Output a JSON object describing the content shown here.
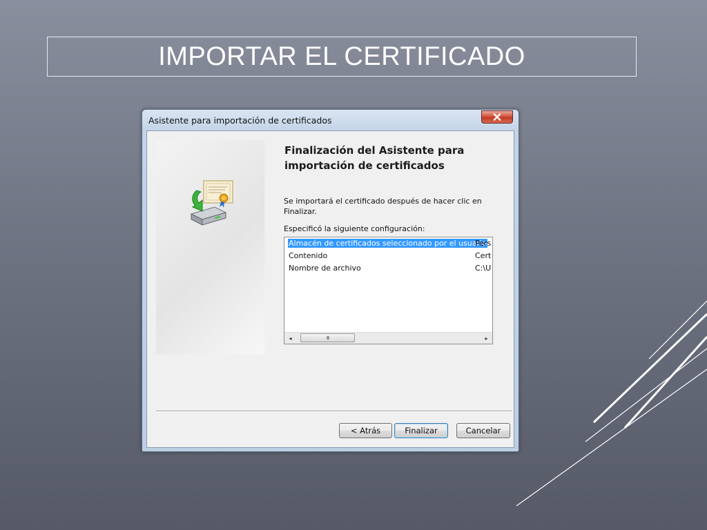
{
  "slide": {
    "title": "IMPORTAR EL CERTIFICADO"
  },
  "window": {
    "title": "Asistente para importación de certificados",
    "close_symbol": "✕"
  },
  "wizard": {
    "heading_line1": "Finalización del Asistente para",
    "heading_line2": "importación de certificados",
    "desc_line1": "Se importará el certificado después de hacer clic en",
    "desc_line2": "Finalizar.",
    "config_label": "Especificó la siguiente configuración:",
    "settings": [
      {
        "name": "Almacén de certificados seleccionado por el usuario",
        "value": "Pers",
        "selected": true
      },
      {
        "name": "Contenido",
        "value": "Cert",
        "selected": false
      },
      {
        "name": "Nombre de archivo",
        "value": "C:\\U",
        "selected": false
      }
    ],
    "scroll_left": "◂",
    "scroll_right": "▸",
    "scroll_thumb": "III"
  },
  "buttons": {
    "back": "< Atrás",
    "finish": "Finalizar",
    "cancel": "Cancelar"
  },
  "icons": [
    "close-icon",
    "certificate-import-icon"
  ],
  "colors": {
    "selection": "#3399ff",
    "close_button": "#c23a24"
  }
}
